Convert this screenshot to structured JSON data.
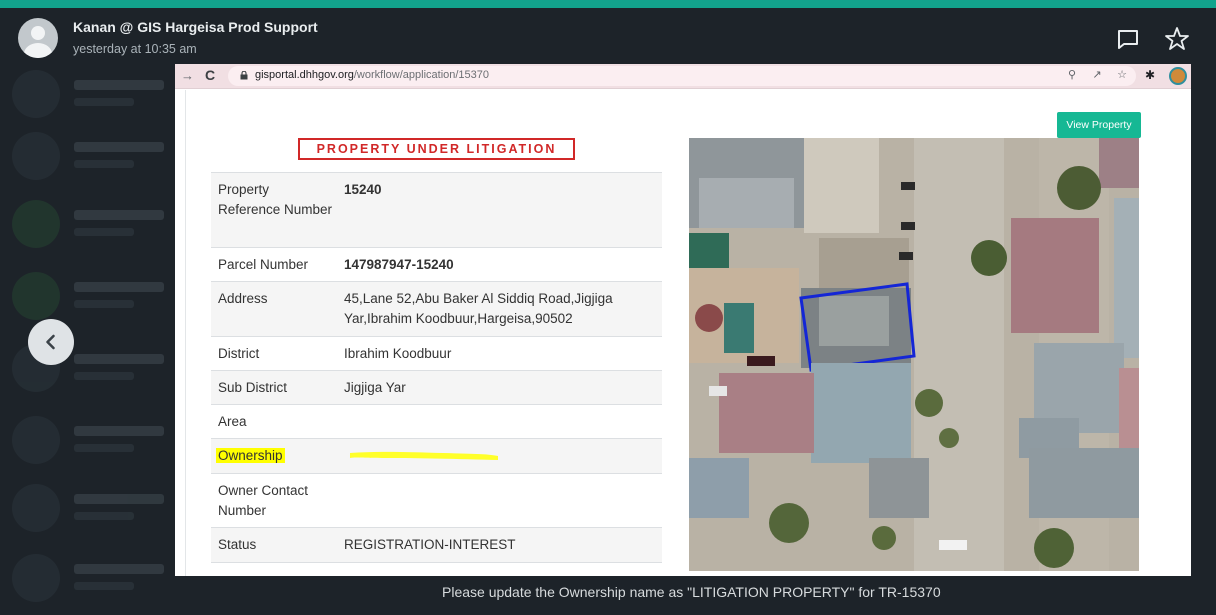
{
  "header": {
    "sender_name": "Kanan @ GIS Hargeisa Prod Support",
    "timestamp": "yesterday at 10:35 am",
    "icons": [
      "comment-icon",
      "star-icon"
    ]
  },
  "browser": {
    "url_host": "gisportal.dhhgov.org",
    "url_path": "/workflow/application/15370"
  },
  "property": {
    "banner": "PROPERTY UNDER LITIGATION",
    "view_button": "View Property",
    "rows": [
      {
        "label": "Property Reference Number",
        "value": "15240"
      },
      {
        "label": "Parcel Number",
        "value": "147987947-15240"
      },
      {
        "label": "Address",
        "value": "45,Lane 52,Abu Baker Al Siddiq Road,Jigjiga Yar,Ibrahim Koodbuur,Hargeisa,90502"
      },
      {
        "label": "District",
        "value": "Ibrahim Koodbuur"
      },
      {
        "label": "Sub District",
        "value": "Jigjiga Yar"
      },
      {
        "label": "Area",
        "value": ""
      },
      {
        "label": "Ownership",
        "value": ""
      },
      {
        "label": "Owner Contact Number",
        "value": ""
      },
      {
        "label": "Status",
        "value": "REGISTRATION-INTEREST"
      }
    ]
  },
  "caption": "Please update the Ownership name as \"LITIGATION PROPERTY\" for TR-15370",
  "colors": {
    "accent": "#12a38c",
    "button": "#16b894",
    "banner_red": "#d12828",
    "highlight": "#ffff00",
    "boundary_blue": "#1426d6"
  }
}
